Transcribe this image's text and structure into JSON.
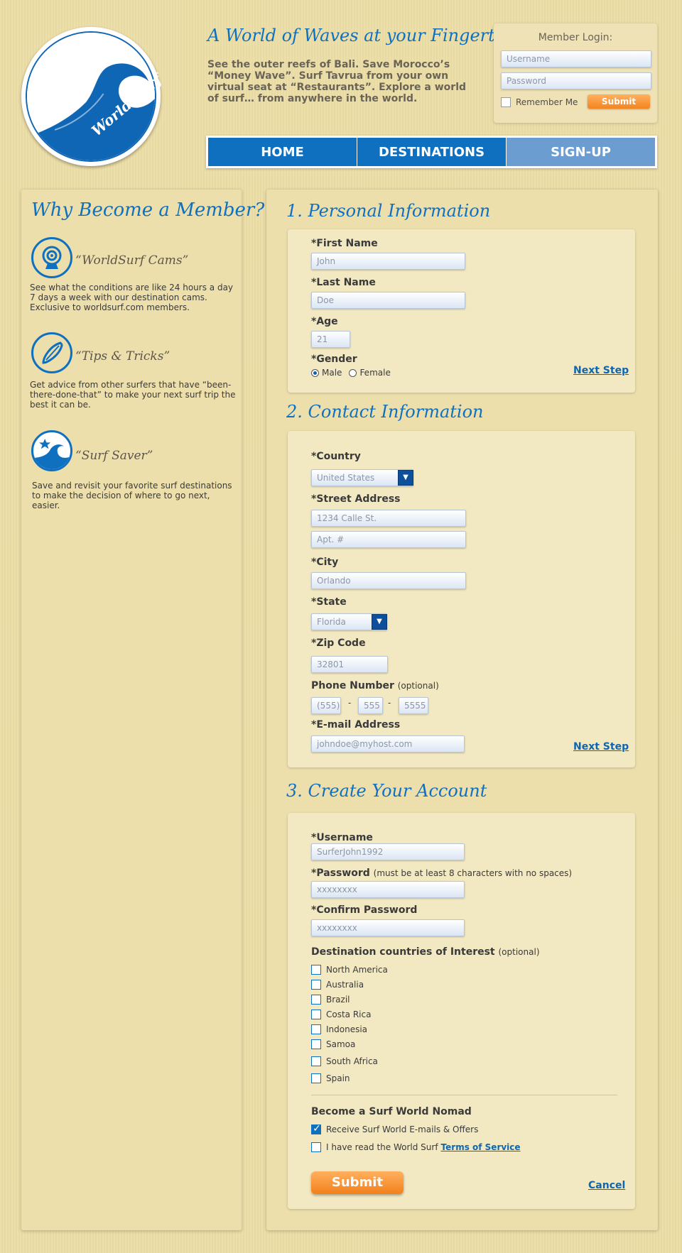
{
  "brand": {
    "logo_text": "World Surf"
  },
  "header": {
    "tagline": "A World of Waves at your Fingertips",
    "intro": "See the outer reefs of Bali. Save Morocco’s “Money Wave”. Surf Tavrua from your own virtual seat at “Restaurants”. Explore a world of surf… from anywhere in the world."
  },
  "login": {
    "title": "Member Login:",
    "username_placeholder": "Username",
    "password_placeholder": "Password",
    "remember_label": "Remember Me",
    "remember_checked": false,
    "submit_label": "Submit"
  },
  "nav": {
    "items": [
      {
        "label": "HOME"
      },
      {
        "label": "DESTINATIONS"
      },
      {
        "label": "SIGN-UP"
      }
    ],
    "active": "SIGN-UP"
  },
  "sidebar": {
    "title": "Why Become a Member?",
    "features": [
      {
        "icon": "webcam-icon",
        "title": "“WorldSurf Cams”",
        "desc": "See what the conditions are like 24 hours a day 7 days a week with our destination cams. Exclusive to worldsurf.com members."
      },
      {
        "icon": "surfboard-icon",
        "title": "“Tips & Tricks”",
        "desc": "Get advice from other surfers that have “been-there-done-that” to make your next surf trip the best it can be."
      },
      {
        "icon": "star-wave-icon",
        "title": "“Surf Saver”",
        "desc": "Save and revisit your favorite surf destinations to make the decision of where to go next, easier."
      }
    ]
  },
  "personal": {
    "title": "1. Personal Information",
    "first_name_label": "*First Name",
    "first_name": "John",
    "last_name_label": "*Last Name",
    "last_name": "Doe",
    "age_label": "*Age",
    "age": "21",
    "gender_label": "*Gender",
    "gender_male": "Male",
    "gender_female": "Female",
    "gender_selected": "Male",
    "next_label": "Next Step"
  },
  "contact": {
    "title": "2. Contact Information",
    "country_label": "*Country",
    "country": "United States",
    "street_label": "*Street Address",
    "street": "1234 Calle St.",
    "apt": "Apt. #",
    "city_label": "*City",
    "city": "Orlando",
    "state_label": "*State",
    "state": "Florida",
    "zip_label": "*Zip Code",
    "zip": "32801",
    "phone_label": "Phone Number",
    "phone_optional": "(optional)",
    "phone_area": "(555)",
    "phone_prefix": "555",
    "phone_line": "5555",
    "phone_sep": "-",
    "email_label": "*E-mail Address",
    "email": "johndoe@myhost.com",
    "next_label": "Next Step"
  },
  "account": {
    "title": "3. Create Your Account",
    "username_label": "*Username",
    "username": "SurferJohn1992",
    "password_label": "*Password",
    "password_note": "(must be at least 8 characters with no spaces)",
    "password": "xxxxxxxx",
    "confirm_label": "*Confirm Password",
    "confirm": "xxxxxxxx",
    "countries_label": "Destination countries of Interest",
    "countries_optional": "(optional)",
    "countries": [
      "North America",
      "Australia",
      "Brazil",
      "Costa Rica",
      "Indonesia",
      "Samoa",
      "South Africa",
      "Spain"
    ],
    "nomad_label": "Become a Surf World Nomad",
    "offers_label": "Receive Surf World E-mails & Offers",
    "offers_checked": true,
    "terms_prefix": "I have read the World Surf",
    "terms_link": "Terms of Service",
    "terms_checked": false,
    "submit_label": "Submit",
    "cancel_label": "Cancel"
  },
  "colors": {
    "brand_blue": "#1070c0",
    "accent_orange": "#f5841e",
    "nav_active": "#6c9dd0",
    "background": "#ecdda6"
  }
}
